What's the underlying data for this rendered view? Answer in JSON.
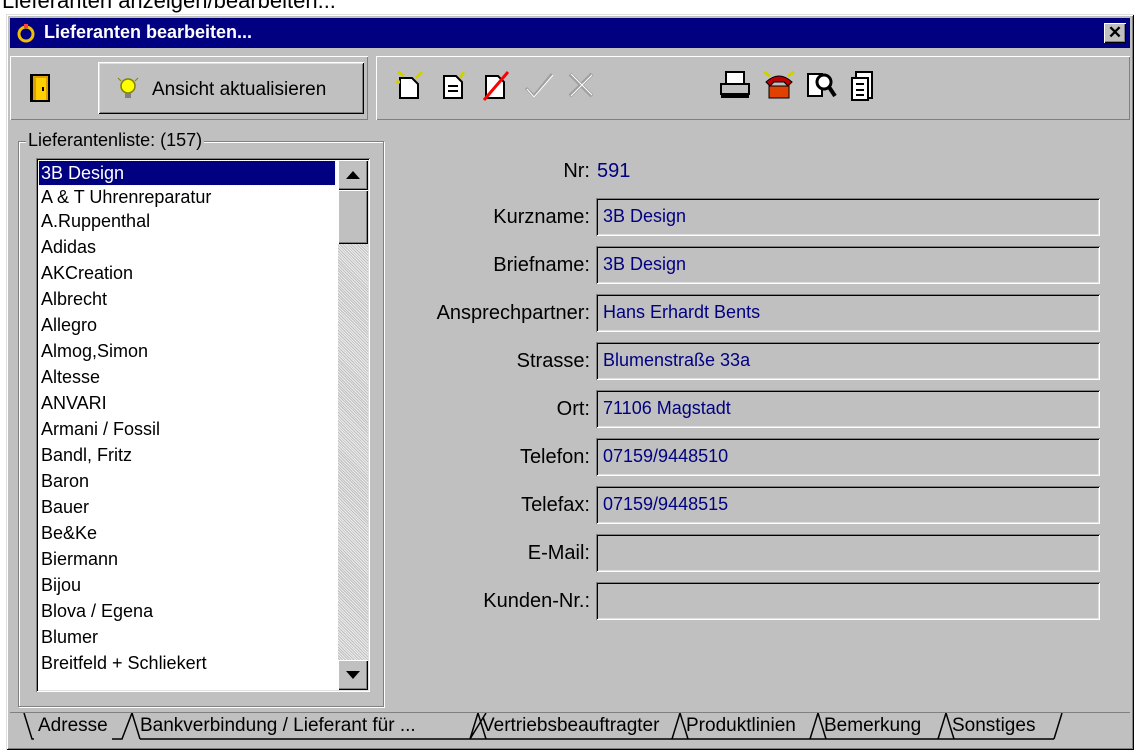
{
  "above_text": "Lieferanten anzeigen/bearbeiten...",
  "window": {
    "title": "Lieferanten bearbeiten...",
    "close_label": "✕"
  },
  "toolbar": {
    "refresh_label": "Ansicht aktualisieren",
    "icons": [
      "exit-door-icon",
      "new-document-icon",
      "copy-document-icon",
      "delete-document-icon",
      "confirm-check-icon",
      "cancel-x-icon",
      "print-icon",
      "phone-icon",
      "search-icon",
      "notes-icon"
    ]
  },
  "supplier_list": {
    "legend": "Lieferantenliste: (157)",
    "items": [
      "3B Design",
      "A & T Uhrenreparatur",
      "A.Ruppenthal",
      "Adidas",
      "AKCreation",
      "Albrecht",
      "Allegro",
      "Almog,Simon",
      "Altesse",
      "ANVARI",
      "Armani / Fossil",
      "Bandl, Fritz",
      "Baron",
      "Bauer",
      "Be&Ke",
      "Biermann",
      "Bijou",
      "Blova / Egena",
      "Blumer",
      "Breitfeld + Schliekert"
    ],
    "selected": "3B Design"
  },
  "form": {
    "nr_label": "Nr:",
    "nr_value": "591",
    "fields": [
      {
        "label": "Kurzname:",
        "value": "3B Design"
      },
      {
        "label": "Briefname:",
        "value": "3B Design"
      },
      {
        "label": "Ansprechpartner:",
        "value": "Hans Erhardt Bents"
      },
      {
        "label": "Strasse:",
        "value": "Blumenstraße 33a"
      },
      {
        "label": "Ort:",
        "value": "71106 Magstadt"
      },
      {
        "label": "Telefon:",
        "value": "07159/9448510"
      },
      {
        "label": "Telefax:",
        "value": "07159/9448515"
      },
      {
        "label": "E-Mail:",
        "value": ""
      },
      {
        "label": "Kunden-Nr.:",
        "value": ""
      }
    ]
  },
  "tabs": [
    {
      "label": "Adresse",
      "active": true
    },
    {
      "label": "Bankverbindung / Lieferant für ...",
      "active": false
    },
    {
      "label": "Vertriebsbeauftragter",
      "active": false
    },
    {
      "label": "Produktlinien",
      "active": false
    },
    {
      "label": "Bemerkung",
      "active": false
    },
    {
      "label": "Sonstiges",
      "active": false
    }
  ]
}
